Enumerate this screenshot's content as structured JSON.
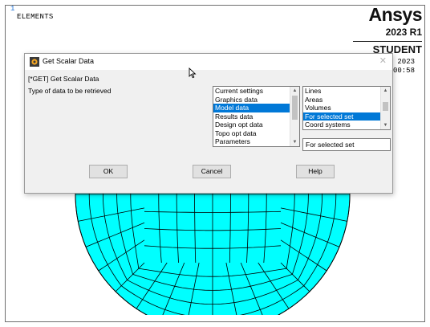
{
  "window_number": "1",
  "graphics_title": "ELEMENTS",
  "logo": {
    "brand": "Ansys",
    "version": "2023 R1",
    "edition": "STUDENT"
  },
  "date_text": {
    "line1": "2023",
    "line2": "00:58"
  },
  "mesh": {
    "fill_color": "#00ffff",
    "line_color": "#000000"
  },
  "dialog": {
    "title": "Get Scalar Data",
    "command_label": "[*GET]  Get Scalar Data",
    "prompt_label": "Type of data to be retrieved",
    "list1": {
      "items": [
        "Current settings",
        "Graphics data",
        "Model data",
        "Results data",
        "Design opt data",
        "Topo opt data",
        "Parameters"
      ],
      "selected": "Model data"
    },
    "list2": {
      "items": [
        "Lines",
        "Areas",
        "Volumes",
        "For selected set",
        "Coord systems"
      ],
      "selected": "For selected set"
    },
    "selection_value": "For selected set",
    "buttons": {
      "ok": "OK",
      "cancel": "Cancel",
      "help": "Help"
    }
  },
  "icons": [
    "ansys-app-icon",
    "close-icon",
    "scroll-up-icon",
    "scroll-down-icon",
    "mouse-cursor-icon"
  ]
}
